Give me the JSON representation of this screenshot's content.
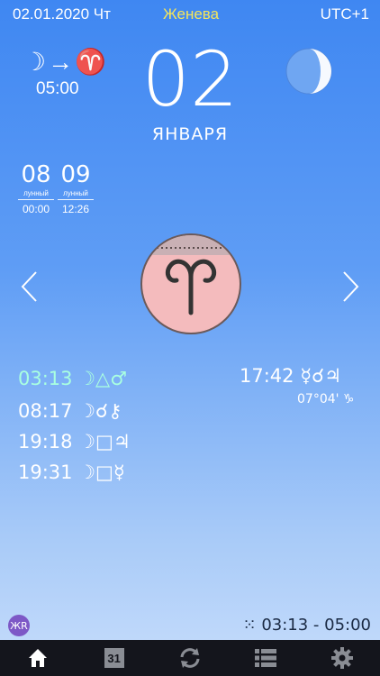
{
  "status": {
    "date": "02.01.2020 Чт",
    "city": "Женева",
    "tz": "UTC+1"
  },
  "moon_transit": {
    "signs": "☽→♈",
    "time": "05:00"
  },
  "date": {
    "day": "02",
    "month": "ЯНВАРЯ"
  },
  "lunar_days": [
    {
      "num": "08",
      "caption": "лунный",
      "time": "00:00"
    },
    {
      "num": "09",
      "caption": "лунный",
      "time": "12:26"
    }
  ],
  "aspects": [
    {
      "time": "03:13",
      "symbols": "☽△♂"
    },
    {
      "time": "08:17",
      "symbols": "☽☌⚷"
    },
    {
      "time": "19:18",
      "symbols": "☽□♃"
    },
    {
      "time": "19:31",
      "symbols": "☽□☿"
    }
  ],
  "side_event": {
    "time": "17:42",
    "symbols": "☿☌♃",
    "position": "07°04' ♑"
  },
  "void_course": "03:13 - 05:00",
  "tabs": {
    "calendar_number": "31"
  },
  "colors": {
    "highlight": "#a9ffe0",
    "sign_circle": "#f4bbbd",
    "tabbar": "#14151c"
  }
}
